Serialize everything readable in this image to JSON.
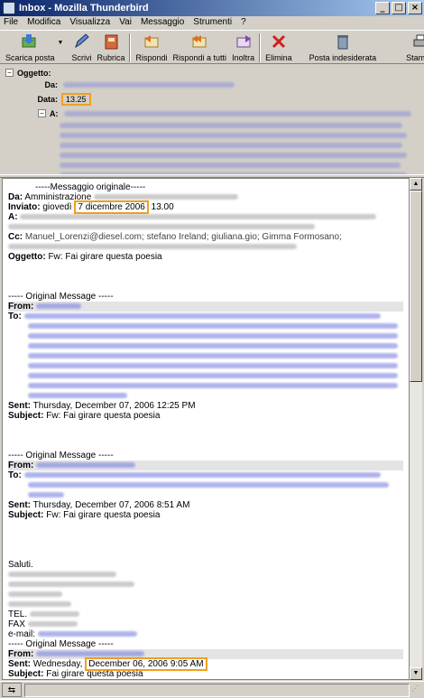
{
  "window": {
    "title": "Inbox - Mozilla Thunderbird",
    "min": "_",
    "max": "□",
    "close": "×"
  },
  "menu": [
    "File",
    "Modifica",
    "Visualizza",
    "Vai",
    "Messaggio",
    "Strumenti",
    "?"
  ],
  "toolbar": {
    "scarica": "Scarica posta",
    "scrivi": "Scrivi",
    "rubrica": "Rubrica",
    "rispondi": "Rispondi",
    "rispondi_tutti": "Rispondi a tutti",
    "inoltra": "Inoltra",
    "elimina": "Elimina",
    "indesiderata": "Posta indesiderata",
    "stampa": "Stampa"
  },
  "headers": {
    "subject_label": "Oggetto:",
    "from_label": "Da:",
    "date_label": "Data:",
    "date_value": "13.25",
    "to_label": "A:"
  },
  "body": {
    "orig_sep": "-----Messaggio originale-----",
    "da_label": "Da:",
    "da_value": "Amministrazione",
    "inviato_label": "Inviato:",
    "inviato_prefix": "giovedì",
    "inviato_date": "7 dicembre 2006",
    "inviato_time": "13.00",
    "a_label": "A:",
    "cc_label": "Cc:",
    "cc_value": "Manuel_Lorenzi@diesel.com; stefano Ireland; giuliana.gio; Gimma Formosano;",
    "oggetto_label": "Oggetto:",
    "oggetto_value": "Fw: Fai girare questa poesia",
    "om1_sep": "----- Original Message -----",
    "from_label": "From:",
    "to_label": "To:",
    "sent_label": "Sent:",
    "subject_label": "Subject:",
    "om1_sent": "Thursday, December 07, 2006 12:25 PM",
    "om1_subject": "Fw: Fai girare questa poesia",
    "om2_sep": "----- Original Message -----",
    "om2_sent": "Thursday, December 07, 2006 8:51 AM",
    "om2_subject": "Fw: Fai girare questa poesia",
    "saluti": "Saluti.",
    "tel_label": "TEL.",
    "fax_label": "FAX",
    "email_label": "e-mail:",
    "om3_sep": "----- Original Message -----",
    "om3_sent_day": "Wednesday,",
    "om3_sent_date": "December 06, 2006 9:05 AM",
    "om3_subject": "Fai girare questa poesia"
  }
}
